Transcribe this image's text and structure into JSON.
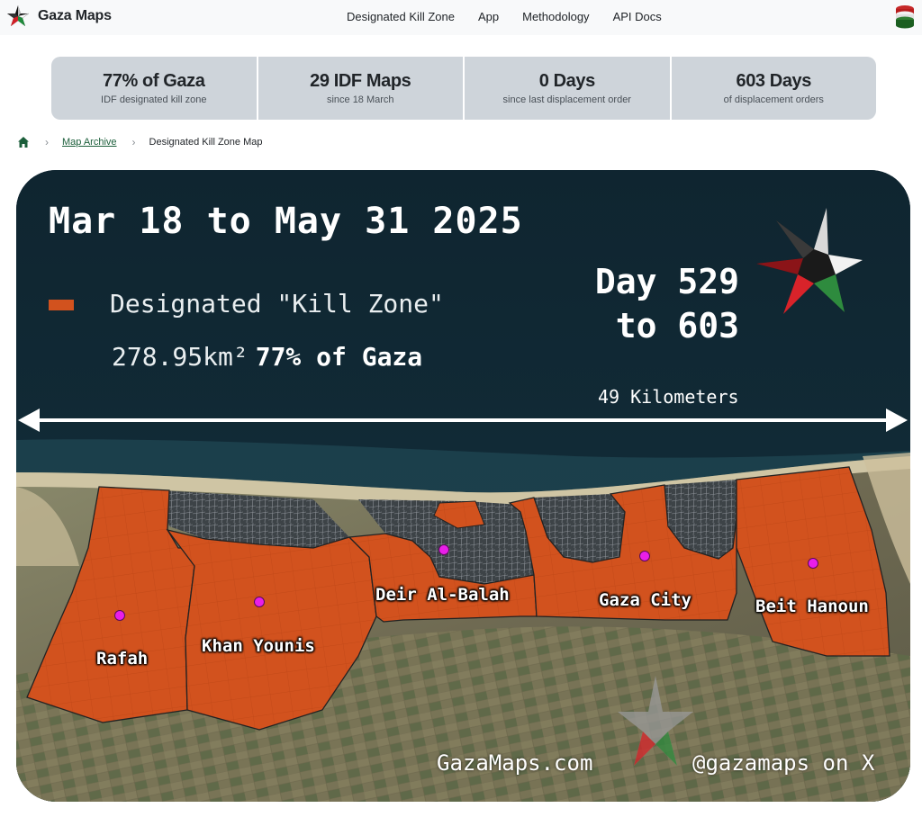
{
  "navbar": {
    "brand": "Gaza Maps",
    "links": [
      {
        "label": "Designated Kill Zone"
      },
      {
        "label": "App"
      },
      {
        "label": "Methodology"
      },
      {
        "label": "API Docs"
      }
    ]
  },
  "stats": [
    {
      "value": "77% of Gaza",
      "label": "IDF designated kill zone"
    },
    {
      "value": "29 IDF Maps",
      "label": "since 18 March"
    },
    {
      "value": "0 Days",
      "label": "since last displacement order"
    },
    {
      "value": "603 Days",
      "label": "of displacement orders"
    }
  ],
  "breadcrumb": {
    "archive": "Map Archive",
    "current": "Designated Kill Zone Map"
  },
  "map": {
    "date_range": "Mar 18 to May 31 2025",
    "legend_label": "Designated \"Kill Zone\"",
    "area_km": "278.95km²",
    "area_pct": "77% of Gaza",
    "day_line1": "Day 529",
    "day_line2": "to 603",
    "distance": "49 Kilometers",
    "towns": {
      "rafah": "Rafah",
      "khan_younis": "Khan Younis",
      "deir_al_balah": "Deir Al-Balah",
      "gaza_city": "Gaza City",
      "beit_hanoun": "Beit Hanoun"
    },
    "footer_site": "GazaMaps.com",
    "footer_handle": "@gazamaps on X",
    "colors": {
      "kill_zone": "#d2521e",
      "town_marker": "#e91ee9",
      "title_band": "#0f2530"
    }
  }
}
